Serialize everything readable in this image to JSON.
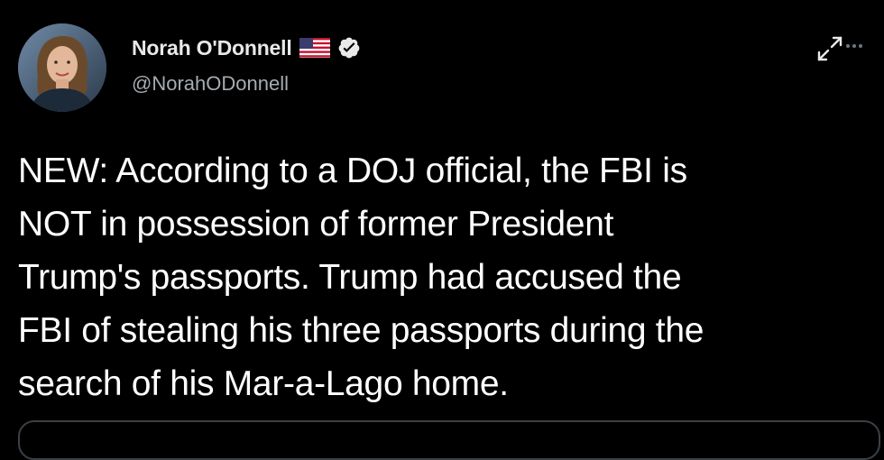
{
  "tweet": {
    "author": {
      "display_name": "Norah O'Donnell",
      "handle": "@NorahODonnell",
      "flag_icon": "us-flag-icon",
      "verified_icon": "verified-badge-icon"
    },
    "text": "NEW: According to a DOJ official, the FBI is\nNOT in possession of former President\nTrump's passports. Trump had accused the\nFBI of stealing his three passports during the\nsearch of his Mar-a-Lago home.",
    "actions": {
      "expand_icon": "expand-arrows-icon",
      "more_icon": "more-options-icon"
    }
  },
  "colors": {
    "background": "#000000",
    "text": "#ffffff",
    "handle": "#a6acb1",
    "verified_badge": "#e7e9ea"
  }
}
